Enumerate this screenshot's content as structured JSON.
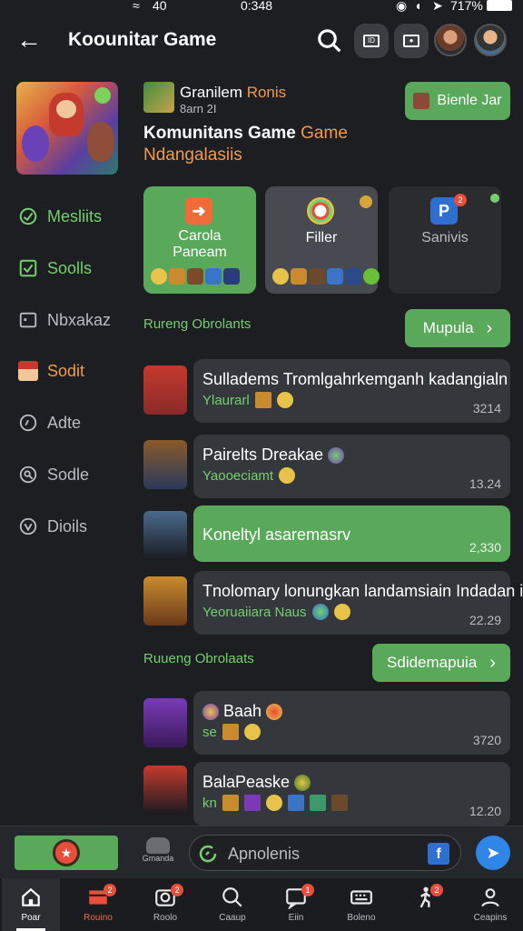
{
  "status": {
    "left": "40",
    "center": "0:348",
    "right": "717%"
  },
  "header": {
    "title": "Koounitar Game",
    "back_label": "back",
    "btn1": "ID"
  },
  "sidebar": {
    "items": [
      {
        "label": "Mesliits",
        "color": "green",
        "icon": "check-circle-icon"
      },
      {
        "label": "Soolls",
        "color": "green",
        "icon": "check-square-icon"
      },
      {
        "label": "Nbxakaz",
        "color": "gray",
        "icon": "square-icon"
      },
      {
        "label": "Sodit",
        "color": "orange",
        "icon": "avatar-icon"
      },
      {
        "label": "Adte",
        "color": "gray",
        "icon": "chat-icon"
      },
      {
        "label": "Sodle",
        "color": "gray",
        "icon": "search-icon"
      },
      {
        "label": "Dioils",
        "color": "gray",
        "icon": "down-circle-icon"
      }
    ]
  },
  "group": {
    "name_white": "Granilem",
    "name_orange": "Ronis",
    "sub": "8arn 2I",
    "title_white": "Komunitans Game",
    "title_orange": "Game",
    "subtitle": "Ndangalasiis",
    "cta": "Bienle Jar"
  },
  "cards": [
    {
      "label": "Carola Paneam",
      "style": "green",
      "icon": "arrow-right-icon"
    },
    {
      "label": "Filler",
      "style": "gray",
      "icon": "compass-icon"
    },
    {
      "label": "Sanivis",
      "style": "dark",
      "icon": "parking-icon",
      "badge": "2"
    }
  ],
  "section1": {
    "label": "Rureng Obrolants",
    "button": "Mupula"
  },
  "rows": [
    {
      "main": "Sulladems Tromlgahrkemganh kadangialn",
      "sub": "Ylaurarl",
      "time": "3214",
      "active": false
    },
    {
      "main": "Pairelts Dreakae",
      "sub": "Yaooeciamt",
      "time": "13.24",
      "active": false
    },
    {
      "main": "Koneltyl asaremasrv",
      "sub": "",
      "time": "2,330",
      "active": true
    },
    {
      "main": "Tnolomary lonungkan landamsiain Indadan in.",
      "sub": "Yeoruaiiara Naus",
      "time": "22.29",
      "active": false
    }
  ],
  "section2": {
    "label": "Ruueng Obrolaats",
    "button": "Sdidemapuia"
  },
  "rows2": [
    {
      "main": "Baah",
      "sub": "se",
      "time": "3720"
    },
    {
      "main": "BalaPeaske",
      "sub": "kn",
      "time": "12.20"
    }
  ],
  "composer": {
    "icon_label": "Gmanda",
    "placeholder": "Apnolenis"
  },
  "tabs": [
    {
      "label": "Poar",
      "active": true
    },
    {
      "label": "Rouino",
      "badge": "2"
    },
    {
      "label": "Roolo",
      "badge": "2"
    },
    {
      "label": "Caaup"
    },
    {
      "label": "Eiin",
      "badge": "1"
    },
    {
      "label": "Boleno"
    },
    {
      "label": "",
      "badge": "2"
    },
    {
      "label": "Ceapins"
    }
  ]
}
